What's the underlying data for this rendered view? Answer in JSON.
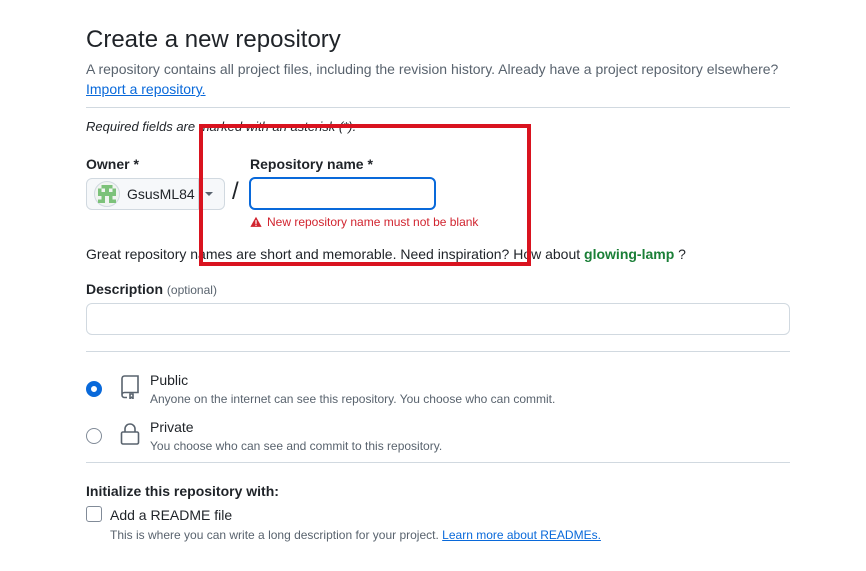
{
  "header": {
    "title": "Create a new repository",
    "subtitle": "A repository contains all project files, including the revision history. Already have a project repository elsewhere?",
    "import_link": "Import a repository."
  },
  "required_note": "Required fields are marked with an asterisk (*).",
  "owner": {
    "label": "Owner *",
    "value": "GsusML84",
    "avatar_icon": "identicon-avatar"
  },
  "separator": "/",
  "repo_name": {
    "label": "Repository name *",
    "value": "",
    "error": "New repository name must not be blank",
    "error_color": "#d1242f"
  },
  "suggestion": {
    "prefix": "Great repository names are short and memorable. Need inspiration? How about",
    "name": "glowing-lamp",
    "suffix": "?"
  },
  "description": {
    "label": "Description",
    "optional": "(optional)",
    "value": ""
  },
  "visibility": {
    "selected": "Public",
    "options": [
      {
        "title": "Public",
        "desc": "Anyone on the internet can see this repository. You choose who can commit.",
        "icon": "repo-icon"
      },
      {
        "title": "Private",
        "desc": "You choose who can see and commit to this repository.",
        "icon": "lock-icon"
      }
    ]
  },
  "initialize": {
    "label": "Initialize this repository with:",
    "readme_title": "Add a README file",
    "readme_desc": "This is where you can write a long description for your project.",
    "readme_link": "Learn more about READMEs."
  },
  "colors": {
    "accent": "#0969da",
    "success": "#1a7f37",
    "danger": "#d1242f",
    "highlight": "#d9131f"
  }
}
